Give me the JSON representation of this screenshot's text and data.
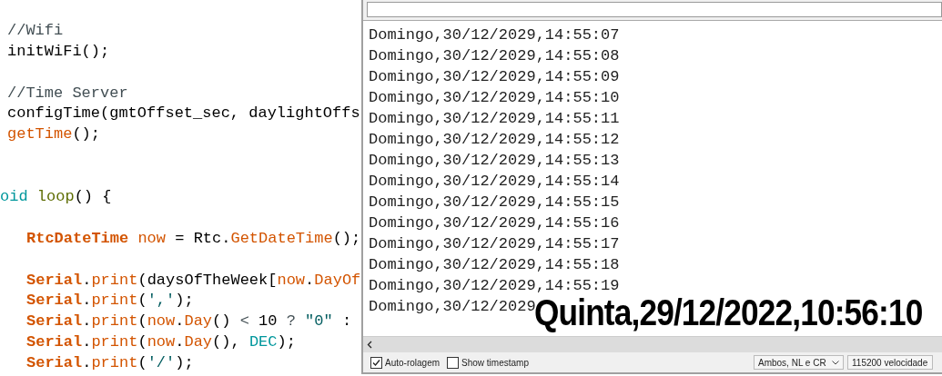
{
  "code_editor": {
    "lines": [
      {
        "kind": "blank"
      },
      {
        "kind": "code",
        "indented": false,
        "tokens": [
          {
            "text": "//Wifi",
            "kind": "comment"
          }
        ]
      },
      {
        "kind": "code",
        "indented": false,
        "tokens": [
          {
            "text": "initWiFi();",
            "kind": "plain"
          }
        ]
      },
      {
        "kind": "blank"
      },
      {
        "kind": "code",
        "indented": false,
        "tokens": [
          {
            "text": "//Time Server",
            "kind": "comment"
          }
        ]
      },
      {
        "kind": "code",
        "indented": false,
        "tokens": [
          {
            "text": "configTime(gmtOffset_sec, daylightOffs",
            "kind": "plain"
          }
        ]
      },
      {
        "kind": "code",
        "indented": false,
        "tokens": [
          {
            "text": "getTime",
            "kind": "func"
          },
          {
            "text": "();",
            "kind": "plain"
          }
        ]
      },
      {
        "kind": "blank"
      },
      {
        "kind": "blank"
      },
      {
        "kind": "code",
        "indented": false,
        "tokens": [
          {
            "text": "oid",
            "kind": "type"
          },
          {
            "text": " loop",
            "kind": "loopfn"
          },
          {
            "text": "() {",
            "kind": "plain"
          }
        ]
      },
      {
        "kind": "blank"
      },
      {
        "kind": "code",
        "indented": true,
        "tokens": [
          {
            "text": "RtcDateTime",
            "kind": "class"
          },
          {
            "text": " now",
            "kind": "func"
          },
          {
            "text": " = Rtc.",
            "kind": "plain"
          },
          {
            "text": "GetDateTime",
            "kind": "func"
          },
          {
            "text": "();",
            "kind": "plain"
          }
        ]
      },
      {
        "kind": "blank"
      },
      {
        "kind": "code",
        "indented": true,
        "tokens": [
          {
            "text": "Serial",
            "kind": "class"
          },
          {
            "text": ".",
            "kind": "plain"
          },
          {
            "text": "print",
            "kind": "func"
          },
          {
            "text": "(daysOfTheWeek[",
            "kind": "plain"
          },
          {
            "text": "now",
            "kind": "func"
          },
          {
            "text": ".",
            "kind": "plain"
          },
          {
            "text": "DayOf",
            "kind": "func"
          }
        ]
      },
      {
        "kind": "code",
        "indented": true,
        "tokens": [
          {
            "text": "Serial",
            "kind": "class"
          },
          {
            "text": ".",
            "kind": "plain"
          },
          {
            "text": "print",
            "kind": "func"
          },
          {
            "text": "(",
            "kind": "plain"
          },
          {
            "text": "','",
            "kind": "string"
          },
          {
            "text": ");",
            "kind": "plain"
          }
        ]
      },
      {
        "kind": "code",
        "indented": true,
        "tokens": [
          {
            "text": "Serial",
            "kind": "class"
          },
          {
            "text": ".",
            "kind": "plain"
          },
          {
            "text": "print",
            "kind": "func"
          },
          {
            "text": "(",
            "kind": "plain"
          },
          {
            "text": "now",
            "kind": "func"
          },
          {
            "text": ".",
            "kind": "plain"
          },
          {
            "text": "Day",
            "kind": "func"
          },
          {
            "text": "() ",
            "kind": "plain"
          },
          {
            "text": "<",
            "kind": "operator"
          },
          {
            "text": " 10 ",
            "kind": "plain"
          },
          {
            "text": "?",
            "kind": "operator"
          },
          {
            "text": " \"0\"",
            "kind": "string"
          },
          {
            "text": " :",
            "kind": "plain"
          }
        ]
      },
      {
        "kind": "code",
        "indented": true,
        "tokens": [
          {
            "text": "Serial",
            "kind": "class"
          },
          {
            "text": ".",
            "kind": "plain"
          },
          {
            "text": "print",
            "kind": "func"
          },
          {
            "text": "(",
            "kind": "plain"
          },
          {
            "text": "now",
            "kind": "func"
          },
          {
            "text": ".",
            "kind": "plain"
          },
          {
            "text": "Day",
            "kind": "func"
          },
          {
            "text": "(), ",
            "kind": "plain"
          },
          {
            "text": "DEC",
            "kind": "const"
          },
          {
            "text": ");",
            "kind": "plain"
          }
        ]
      },
      {
        "kind": "code",
        "indented": true,
        "tokens": [
          {
            "text": "Serial",
            "kind": "class"
          },
          {
            "text": ".",
            "kind": "plain"
          },
          {
            "text": "print",
            "kind": "func"
          },
          {
            "text": "(",
            "kind": "plain"
          },
          {
            "text": "'/'",
            "kind": "string"
          },
          {
            "text": ");",
            "kind": "plain"
          }
        ]
      }
    ]
  },
  "serial_monitor": {
    "output_lines": [
      "Domingo,30/12/2029,14:55:07",
      "Domingo,30/12/2029,14:55:08",
      "Domingo,30/12/2029,14:55:09",
      "Domingo,30/12/2029,14:55:10",
      "Domingo,30/12/2029,14:55:11",
      "Domingo,30/12/2029,14:55:12",
      "Domingo,30/12/2029,14:55:13",
      "Domingo,30/12/2029,14:55:14",
      "Domingo,30/12/2029,14:55:15",
      "Domingo,30/12/2029,14:55:16",
      "Domingo,30/12/2029,14:55:17",
      "Domingo,30/12/2029,14:55:18",
      "Domingo,30/12/2029,14:55:19",
      "Domingo,30/12/2029"
    ],
    "autoscroll": {
      "label": "Auto-rolagem",
      "checked": true
    },
    "timestamp": {
      "label": "Show timestamp",
      "checked": false
    },
    "line_ending": "Ambos, NL e CR",
    "baud_rate": "115200 velocidade"
  },
  "overlay_text": "Quinta,29/12/2022,10:56:10"
}
